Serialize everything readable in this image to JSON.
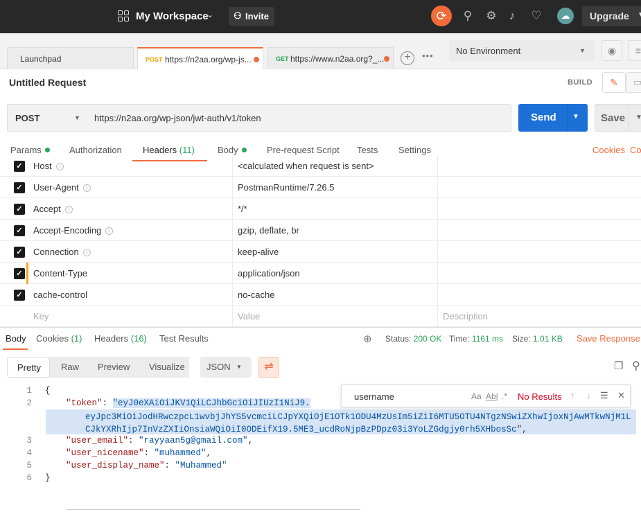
{
  "workspace": {
    "title": "My Workspace",
    "invite_label": "Invite",
    "upgrade_label": "Upgrade",
    "avatar_glyph": "☁"
  },
  "tabs": [
    {
      "label": "Launchpad"
    },
    {
      "method": "POST",
      "url": "https://n2aa.org/wp-js..."
    },
    {
      "method": "GET",
      "url": "https://www.n2aa.org?_..."
    }
  ],
  "environment": {
    "selected": "No Environment"
  },
  "request": {
    "title": "Untitled Request",
    "build_label": "BUILD",
    "method": "POST",
    "url": "https://n2aa.org/wp-json/jwt-auth/v1/token",
    "send_label": "Send",
    "save_label": "Save"
  },
  "request_tabs": {
    "params": "Params",
    "authorization": "Authorization",
    "headers": "Headers",
    "headers_count": "(11)",
    "body": "Body",
    "pre_request": "Pre-request Script",
    "tests": "Tests",
    "settings": "Settings",
    "cookies": "Cookies",
    "code": "Co"
  },
  "headers": [
    {
      "key": "Host",
      "value": "<calculated when request is sent>"
    },
    {
      "key": "User-Agent",
      "value": "PostmanRuntime/7.26.5"
    },
    {
      "key": "Accept",
      "value": "*/*"
    },
    {
      "key": "Accept-Encoding",
      "value": "gzip, deflate, br"
    },
    {
      "key": "Connection",
      "value": "keep-alive"
    },
    {
      "key": "Content-Type",
      "value": "application/json"
    },
    {
      "key": "cache-control",
      "value": "no-cache"
    }
  ],
  "headers_placeholder": {
    "key": "Key",
    "value": "Value",
    "description": "Description"
  },
  "response_tabs": {
    "body": "Body",
    "cookies": "Cookies",
    "cookies_count": "(1)",
    "headers": "Headers",
    "headers_count": "(16)",
    "test_results": "Test Results"
  },
  "response_status": {
    "status_label": "Status:",
    "status": "200 OK",
    "time_label": "Time:",
    "time": "1161 ms",
    "size_label": "Size:",
    "size": "1.01 KB",
    "save_response": "Save Response"
  },
  "response_format": {
    "pretty": "Pretty",
    "raw": "Raw",
    "preview": "Preview",
    "visualize": "Visualize",
    "language": "JSON"
  },
  "find": {
    "query": "username",
    "match_case": "Aa",
    "whole_word": "Ab|",
    "regex": ".*",
    "result": "No Results"
  },
  "code": {
    "line_numbers": [
      "1",
      "2",
      "3",
      "4",
      "5",
      "6"
    ],
    "open": "{",
    "close": "}",
    "token_key": "\"token\"",
    "token_line1": "\"eyJ0eXAiOiJKV1QiLCJhbGciOiJIUzI1NiJ9.",
    "token_line2": "eyJpc3MiOiJodHRwczpcL1wvbjJhYS5vcmciLCJpYXQiOjE1OTk1ODU4MzUsIm5iZiI6MTU5OTU4NTgzNSwiZXhwIjoxNjAwMTkwNjM1LCJkYXRhIjp7InVzZXIiOnsiaWQiOiI0ODEifX19.5ME3_ucdRoNjpBzPDpz03i3YoLZGdgjy0rh5XHbosSc",
    "token_line3_tail": "\",",
    "email_key": "\"user_email\"",
    "email_val": "\"rayyaan5g@gmail.com\"",
    "nicename_key": "\"user_nicename\"",
    "nicename_val": "\"muhammed\"",
    "display_key": "\"user_display_name\"",
    "display_val": "\"Muhammed\""
  }
}
